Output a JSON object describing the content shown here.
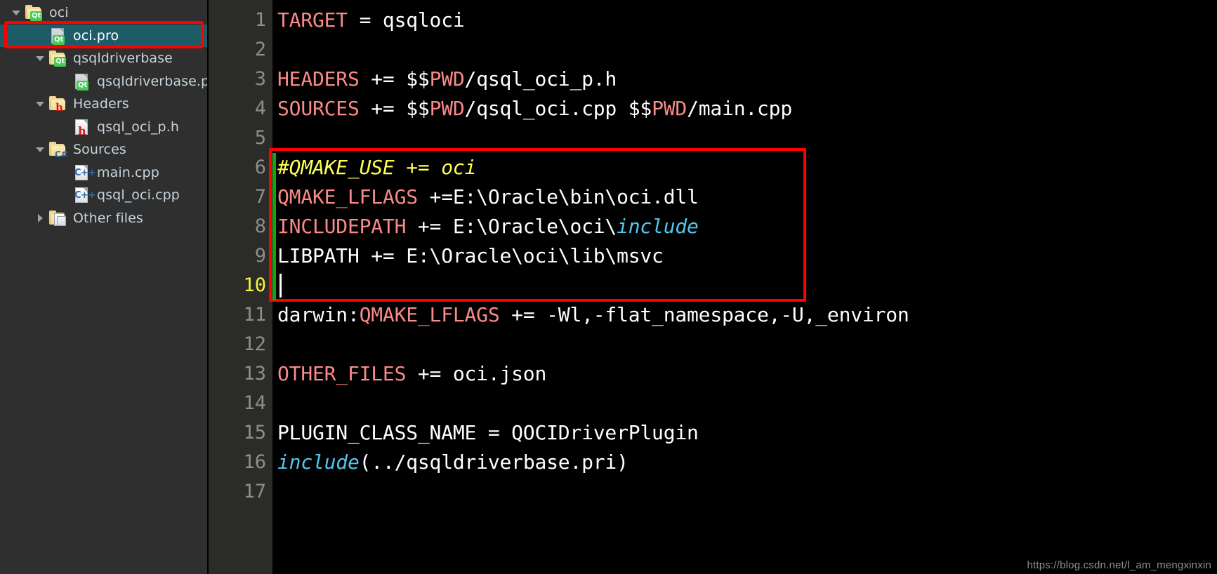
{
  "colors": {
    "sidebar_bg": "#2e2f2e",
    "selection_bg": "#1d5c66",
    "annotation_red": "#ff0000",
    "editor_bg": "#000000",
    "gutter_bg": "#2b2c29",
    "keyword": "#f98a87",
    "include_func": "#52c7ee",
    "comment": "#ffff55",
    "current_line_number": "#f7f441",
    "modified_marker": "#16a310",
    "text": "#ffffff"
  },
  "sidebar": {
    "name": "project-tree",
    "items": [
      {
        "label": "oci",
        "icon": "folder-qt-icon",
        "depth": 0,
        "expanded": true,
        "has_arrow": true,
        "selected": false
      },
      {
        "label": "oci.pro",
        "icon": "file-qt-icon",
        "depth": 1,
        "expanded": null,
        "has_arrow": false,
        "selected": true
      },
      {
        "label": "qsqldriverbase",
        "icon": "folder-qt-icon",
        "depth": 1,
        "expanded": true,
        "has_arrow": true,
        "selected": false
      },
      {
        "label": "qsqldriverbase.pri",
        "icon": "file-qt-icon",
        "depth": 2,
        "expanded": null,
        "has_arrow": false,
        "selected": false
      },
      {
        "label": "Headers",
        "icon": "folder-h-icon",
        "depth": 1,
        "expanded": true,
        "has_arrow": true,
        "selected": false
      },
      {
        "label": "qsql_oci_p.h",
        "icon": "file-h-icon",
        "depth": 2,
        "expanded": null,
        "has_arrow": false,
        "selected": false
      },
      {
        "label": "Sources",
        "icon": "folder-cpp-icon",
        "depth": 1,
        "expanded": true,
        "has_arrow": true,
        "selected": false
      },
      {
        "label": "main.cpp",
        "icon": "file-cpp-icon",
        "depth": 2,
        "expanded": null,
        "has_arrow": false,
        "selected": false
      },
      {
        "label": "qsql_oci.cpp",
        "icon": "file-cpp-icon",
        "depth": 2,
        "expanded": null,
        "has_arrow": false,
        "selected": false
      },
      {
        "label": "Other files",
        "icon": "folder-other-icon",
        "depth": 1,
        "expanded": false,
        "has_arrow": true,
        "selected": false
      }
    ]
  },
  "editor": {
    "name": "qmake-pro-file-editor",
    "current_line": 10,
    "caret_line": 10,
    "annotated_line_range": [
      6,
      10
    ],
    "modified_line_range": [
      6,
      10
    ],
    "lines": [
      {
        "n": 1,
        "tokens": [
          {
            "t": "TARGET",
            "c": "kw"
          },
          {
            "t": " = qsqloci",
            "c": "wht"
          }
        ]
      },
      {
        "n": 2,
        "tokens": []
      },
      {
        "n": 3,
        "tokens": [
          {
            "t": "HEADERS",
            "c": "kw"
          },
          {
            "t": " += $$",
            "c": "wht"
          },
          {
            "t": "PWD",
            "c": "kw"
          },
          {
            "t": "/qsql_oci_p.h",
            "c": "wht"
          }
        ]
      },
      {
        "n": 4,
        "tokens": [
          {
            "t": "SOURCES",
            "c": "kw"
          },
          {
            "t": " += $$",
            "c": "wht"
          },
          {
            "t": "PWD",
            "c": "kw"
          },
          {
            "t": "/qsql_oci.cpp $$",
            "c": "wht"
          },
          {
            "t": "PWD",
            "c": "kw"
          },
          {
            "t": "/main.cpp",
            "c": "wht"
          }
        ]
      },
      {
        "n": 5,
        "tokens": []
      },
      {
        "n": 6,
        "tokens": [
          {
            "t": "#QMAKE_USE += oci",
            "c": "cmt"
          }
        ]
      },
      {
        "n": 7,
        "tokens": [
          {
            "t": "QMAKE_LFLAGS",
            "c": "kw"
          },
          {
            "t": " +=E:\\Oracle\\bin\\oci.dll",
            "c": "wht"
          }
        ]
      },
      {
        "n": 8,
        "tokens": [
          {
            "t": "INCLUDEPATH",
            "c": "kw"
          },
          {
            "t": " += E:\\Oracle\\oci\\",
            "c": "wht"
          },
          {
            "t": "include",
            "c": "inc"
          }
        ]
      },
      {
        "n": 9,
        "tokens": [
          {
            "t": "LIBPATH += E:\\Oracle\\oci\\lib\\msvc",
            "c": "wht"
          }
        ]
      },
      {
        "n": 10,
        "tokens": []
      },
      {
        "n": 11,
        "tokens": [
          {
            "t": "darwin:",
            "c": "wht"
          },
          {
            "t": "QMAKE_LFLAGS",
            "c": "kw"
          },
          {
            "t": " += -Wl,-flat_namespace,-U,_environ",
            "c": "wht"
          }
        ]
      },
      {
        "n": 12,
        "tokens": []
      },
      {
        "n": 13,
        "tokens": [
          {
            "t": "OTHER_FILES",
            "c": "kw"
          },
          {
            "t": " += oci.json",
            "c": "wht"
          }
        ]
      },
      {
        "n": 14,
        "tokens": []
      },
      {
        "n": 15,
        "tokens": [
          {
            "t": "PLUGIN_CLASS_NAME = QOCIDriverPlugin",
            "c": "wht"
          }
        ]
      },
      {
        "n": 16,
        "tokens": [
          {
            "t": "include",
            "c": "inc"
          },
          {
            "t": "(../qsqldriverbase.pri)",
            "c": "wht"
          }
        ]
      },
      {
        "n": 17,
        "tokens": []
      }
    ]
  },
  "watermark": {
    "text": "https://blog.csdn.net/l_am_mengxinxin"
  }
}
